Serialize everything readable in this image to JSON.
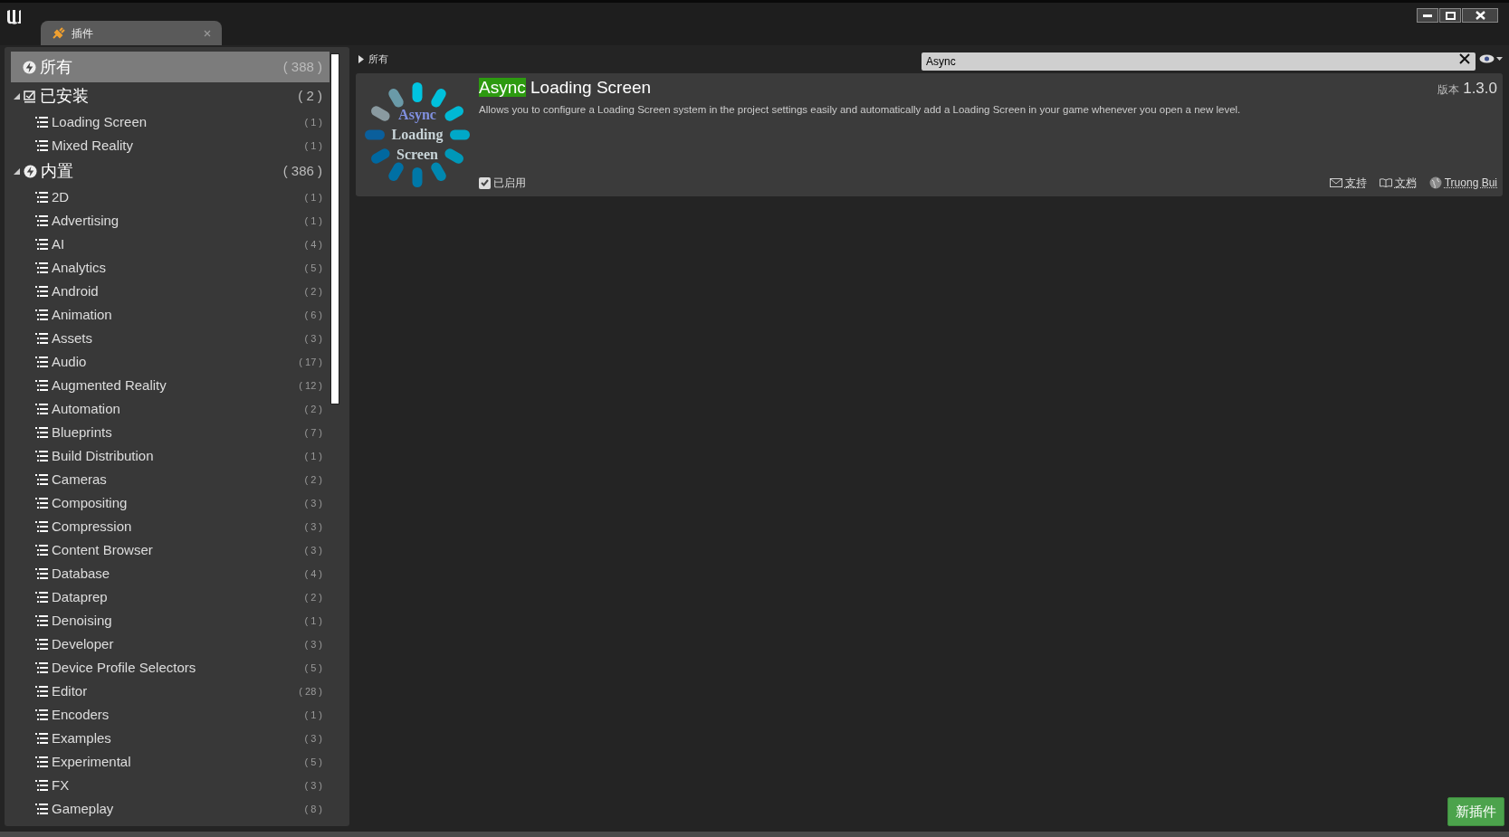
{
  "window": {
    "tab": {
      "label": "插件",
      "selected": true
    }
  },
  "sidebar": {
    "items": [
      {
        "kind": "all",
        "label": "所有",
        "count": "( 388 )",
        "selected": true
      },
      {
        "kind": "group",
        "label": "已安装",
        "count": "( 2 )",
        "expanded": true,
        "selected": false,
        "children": [
          {
            "label": "Loading Screen",
            "count": "( 1 )",
            "selected": false
          },
          {
            "label": "Mixed Reality",
            "count": "( 1 )",
            "selected": false
          }
        ]
      },
      {
        "kind": "group",
        "label": "内置",
        "count": "( 386 )",
        "expanded": true,
        "selected": false,
        "children": [
          {
            "label": "2D",
            "count": "( 1 )",
            "selected": false
          },
          {
            "label": "Advertising",
            "count": "( 1 )",
            "selected": false
          },
          {
            "label": "AI",
            "count": "( 4 )",
            "selected": false
          },
          {
            "label": "Analytics",
            "count": "( 5 )",
            "selected": false
          },
          {
            "label": "Android",
            "count": "( 2 )",
            "selected": false
          },
          {
            "label": "Animation",
            "count": "( 6 )",
            "selected": false
          },
          {
            "label": "Assets",
            "count": "( 3 )",
            "selected": false
          },
          {
            "label": "Audio",
            "count": "( 17 )",
            "selected": false
          },
          {
            "label": "Augmented Reality",
            "count": "( 12 )",
            "selected": false
          },
          {
            "label": "Automation",
            "count": "( 2 )",
            "selected": false
          },
          {
            "label": "Blueprints",
            "count": "( 7 )",
            "selected": false
          },
          {
            "label": "Build Distribution",
            "count": "( 1 )",
            "selected": false
          },
          {
            "label": "Cameras",
            "count": "( 2 )",
            "selected": false
          },
          {
            "label": "Compositing",
            "count": "( 3 )",
            "selected": false
          },
          {
            "label": "Compression",
            "count": "( 3 )",
            "selected": false
          },
          {
            "label": "Content Browser",
            "count": "( 3 )",
            "selected": false
          },
          {
            "label": "Database",
            "count": "( 4 )",
            "selected": false
          },
          {
            "label": "Dataprep",
            "count": "( 2 )",
            "selected": false
          },
          {
            "label": "Denoising",
            "count": "( 1 )",
            "selected": false
          },
          {
            "label": "Developer",
            "count": "( 3 )",
            "selected": false
          },
          {
            "label": "Device Profile Selectors",
            "count": "( 5 )",
            "selected": false
          },
          {
            "label": "Editor",
            "count": "( 28 )",
            "selected": false
          },
          {
            "label": "Encoders",
            "count": "( 1 )",
            "selected": false
          },
          {
            "label": "Examples",
            "count": "( 3 )",
            "selected": false
          },
          {
            "label": "Experimental",
            "count": "( 5 )",
            "selected": false
          },
          {
            "label": "FX",
            "count": "( 3 )",
            "selected": false
          },
          {
            "label": "Gameplay",
            "count": "( 8 )",
            "selected": false
          }
        ]
      }
    ]
  },
  "breadcrumb": "所有",
  "search": {
    "value": "Async"
  },
  "plugins": [
    {
      "icon_lines": [
        "Async",
        "Loading",
        "Screen"
      ],
      "title_parts": [
        {
          "text": "Async",
          "highlighted": true
        },
        {
          "text": " Loading Screen",
          "highlighted": false
        }
      ],
      "description": "Allows you to configure a Loading Screen system in the project settings easily and automatically add a Loading Screen in your game whenever you open a new level.",
      "version_label": "版本",
      "version": "1.3.0",
      "enabled": {
        "label": "已启用",
        "checked": true
      },
      "links": [
        {
          "kind": "support",
          "label": "支持"
        },
        {
          "kind": "docs",
          "label": "文档"
        },
        {
          "kind": "author",
          "label": "Truong Bui"
        }
      ]
    }
  ],
  "new_plugin_button": "新插件"
}
